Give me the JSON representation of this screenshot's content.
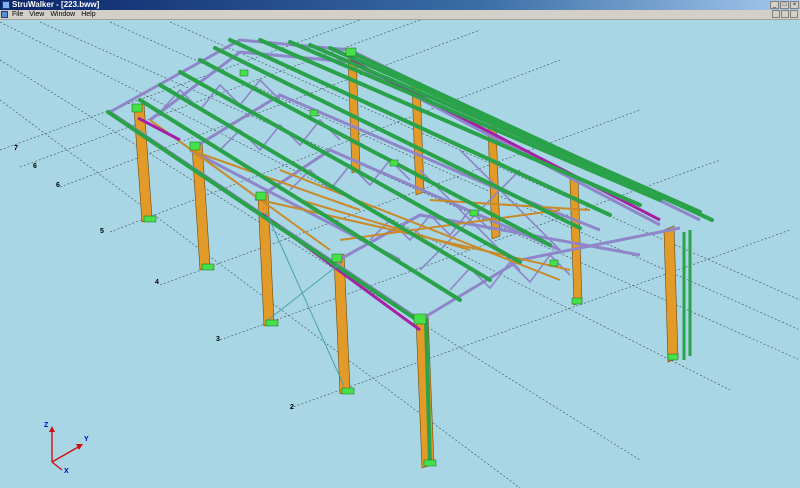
{
  "window": {
    "title": "StruWalker - [223.bww]",
    "controls": [
      "_",
      "□",
      "×"
    ]
  },
  "menu": {
    "items": [
      "File",
      "View",
      "Window",
      "Help"
    ]
  },
  "viewport": {
    "grid_labels": [
      "7",
      "6",
      "6",
      "5",
      "4",
      "3",
      "2"
    ],
    "axes": {
      "z": "Z",
      "y": "Y",
      "x": "X"
    }
  },
  "colors": {
    "background": "#a9d6e5",
    "column": "#e29a28",
    "purlin": "#2aa24a",
    "truss": "#8e86c8",
    "bracing": "#c98a2a",
    "eave_beam": "#a620a6",
    "connection": "#46e04a"
  }
}
